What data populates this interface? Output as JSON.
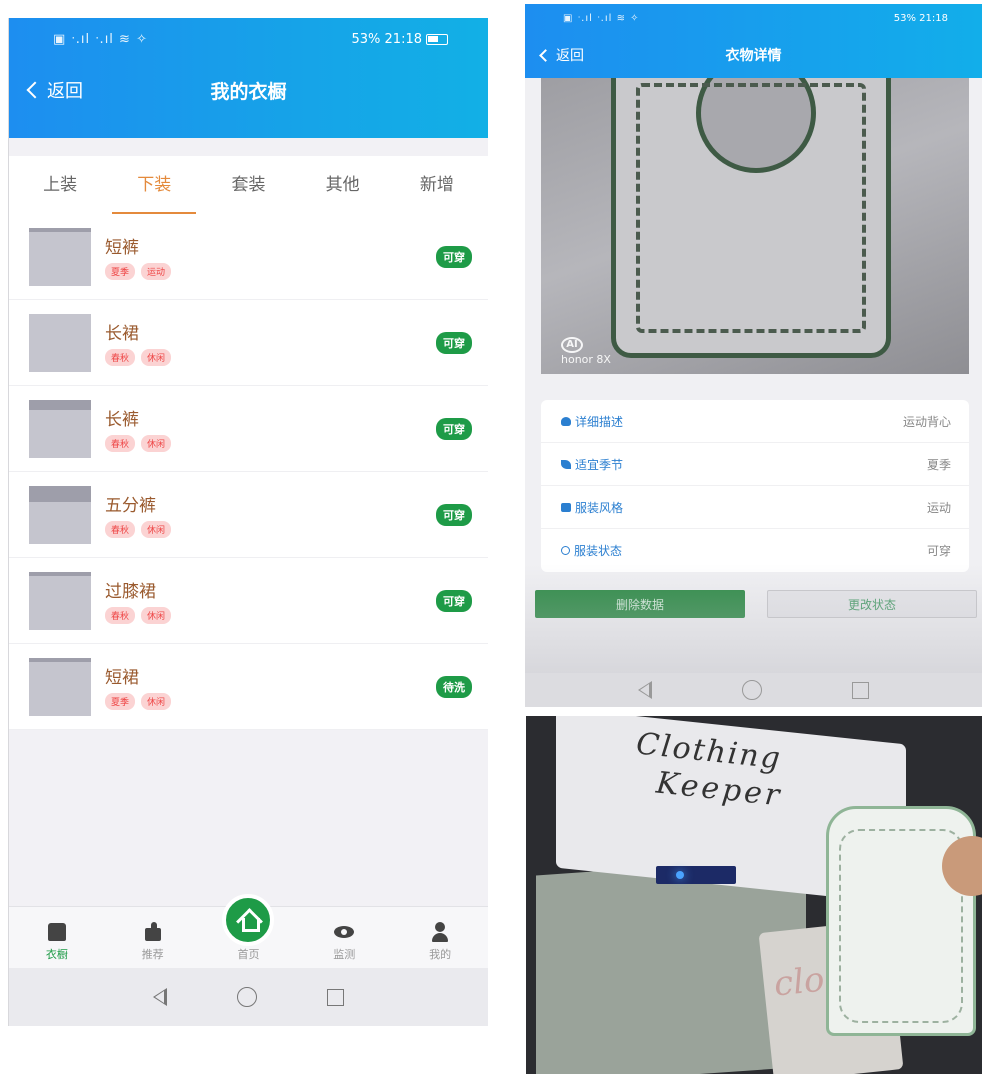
{
  "left_phone": {
    "status_bar": {
      "left": "▣ ᐧ.ıl ᐧ.ıl ≋ ✧",
      "right": "53% 21:18"
    },
    "nav": {
      "back_label": "返回",
      "title": "我的衣橱"
    },
    "tabs": [
      {
        "label": "上装",
        "active": false
      },
      {
        "label": "下装",
        "active": true
      },
      {
        "label": "套装",
        "active": false
      },
      {
        "label": "其他",
        "active": false
      },
      {
        "label": "新增",
        "active": false
      }
    ],
    "items": [
      {
        "name": "短裤",
        "tags": [
          "夏季",
          "运动"
        ],
        "status": "可穿"
      },
      {
        "name": "长裙",
        "tags": [
          "春秋",
          "休闲"
        ],
        "status": "可穿"
      },
      {
        "name": "长裤",
        "tags": [
          "春秋",
          "休闲"
        ],
        "status": "可穿"
      },
      {
        "name": "五分裤",
        "tags": [
          "春秋",
          "休闲"
        ],
        "status": "可穿"
      },
      {
        "name": "过膝裙",
        "tags": [
          "春秋",
          "休闲"
        ],
        "status": "可穿"
      },
      {
        "name": "短裙",
        "tags": [
          "夏季",
          "休闲"
        ],
        "status": "待洗"
      }
    ],
    "bottom_nav": [
      {
        "label": "衣橱",
        "icon": "shirt-icon",
        "active": true
      },
      {
        "label": "推荐",
        "icon": "thumbs-up-icon",
        "active": false
      },
      {
        "label": "首页",
        "icon": "home-icon",
        "active": false
      },
      {
        "label": "监测",
        "icon": "eye-icon",
        "active": false
      },
      {
        "label": "我的",
        "icon": "user-icon",
        "active": false
      }
    ]
  },
  "right_phone": {
    "status_bar": {
      "left": "▣ ᐧ.ıl ᐧ.ıl ≋ ✧",
      "right": "53% 21:18"
    },
    "nav": {
      "back_label": "返回",
      "title": "衣物详情"
    },
    "photo_watermark": "honor 8X",
    "details": [
      {
        "label": "详细描述",
        "value": "运动背心",
        "icon": "cloud-icon"
      },
      {
        "label": "适宜季节",
        "value": "夏季",
        "icon": "leaf-icon"
      },
      {
        "label": "服装风格",
        "value": "运动",
        "icon": "clothing-icon"
      },
      {
        "label": "服装状态",
        "value": "可穿",
        "icon": "status-icon"
      }
    ],
    "buttons": {
      "delete": "删除数据",
      "change": "更改状态"
    }
  },
  "device_photo": {
    "handwriting_line1": "Clothing",
    "handwriting_line2": "Keeper",
    "handwriting_panel": "clo"
  },
  "colors": {
    "header_blue": "#1d8ef0",
    "accent_orange": "#e48a3c",
    "status_green": "#1e9b47",
    "item_name_brown": "#9a5a2e",
    "tag_pink": "#fbd3d3"
  }
}
